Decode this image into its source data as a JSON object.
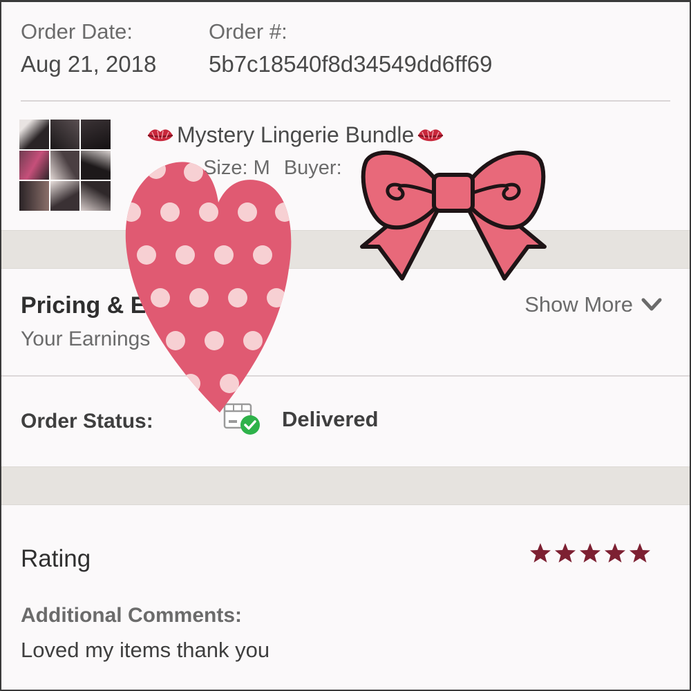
{
  "order": {
    "date_label": "Order Date:",
    "date_value": "Aug 21, 2018",
    "number_label": "Order #:",
    "number_value": "5b7c18540f8d34549dd6ff69"
  },
  "item": {
    "title": "Mystery Lingerie Bundle",
    "size": "Size: M",
    "buyer_label": "Buyer:"
  },
  "pricing": {
    "title": "Pricing & Earnings Info",
    "title_visible": "Pricing & E           fo",
    "subtitle": "Your Earnings",
    "show_more_label": "Show More"
  },
  "status": {
    "label": "Order Status:",
    "value": "Delivered"
  },
  "rating": {
    "title": "Rating",
    "stars": 5,
    "comments_label": "Additional Comments:",
    "comments_text": "Loved my items thank you"
  },
  "colors": {
    "star": "#7d2032",
    "check_green": "#2eb24a",
    "heart_pink": "#e05a72",
    "bow_pink": "#e8697a"
  },
  "icons": {
    "lips": "lips-icon",
    "chevron": "chevron-down-icon",
    "box": "box-delivered-icon",
    "star": "star-icon"
  }
}
